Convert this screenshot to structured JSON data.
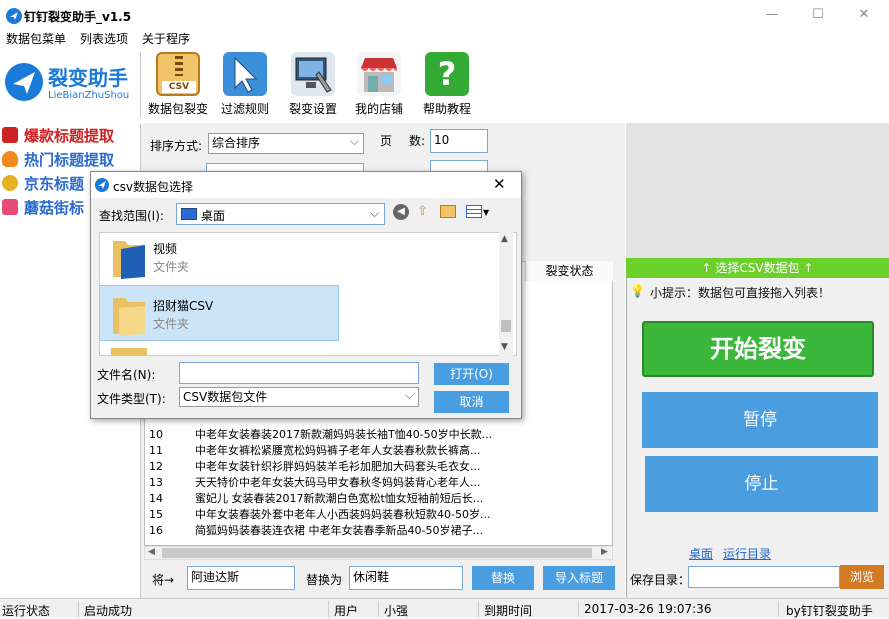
{
  "window": {
    "title": "钉钉裂变助手_v1.5",
    "minimize_icon": "minimize-icon",
    "maximize_icon": "maximize-icon",
    "close_icon": "close-icon"
  },
  "menu": [
    "数据包菜单",
    "列表选项",
    "关于程序"
  ],
  "logo": {
    "cn": "裂变助手",
    "en": "LieBianZhuShou"
  },
  "toolbar": [
    {
      "label": "数据包裂变",
      "icon": "csv-zip-icon",
      "color": "#e8a53a"
    },
    {
      "label": "过滤规则",
      "icon": "cursor-arrow-icon",
      "color": "#3b8fd8"
    },
    {
      "label": "裂变设置",
      "icon": "monitor-wrench-icon",
      "color": "#5577aa"
    },
    {
      "label": "我的店铺",
      "icon": "shop-icon",
      "color": "#cc4444"
    },
    {
      "label": "帮助教程",
      "icon": "help-question-icon",
      "color": "#33aa33"
    }
  ],
  "nav": [
    {
      "label": "爆款标题提取",
      "icon": "explode-icon",
      "color": "#cc2222"
    },
    {
      "label": "热门标题提取",
      "icon": "fire-icon",
      "color": "#2a6ad0"
    },
    {
      "label": "京东标题",
      "icon": "jd-icon",
      "color": "#2a6ad0"
    },
    {
      "label": "蘑菇街标",
      "icon": "mogujie-icon",
      "color": "#2a6ad0"
    }
  ],
  "form": {
    "sort_label": "排序方式:",
    "sort_value": "综合排序",
    "page_label_a": "页",
    "page_label_b": "数:",
    "page_value": "10"
  },
  "list": {
    "header_status": "裂变状态",
    "rows": [
      {
        "num": "10",
        "title": "中老年女装春装2017新款潮妈妈装长袖T恤40-50岁中长款..."
      },
      {
        "num": "11",
        "title": "中老年女裤松紧腰宽松妈妈裤子老年人女装春秋款长裤高..."
      },
      {
        "num": "12",
        "title": "中老年女装针织衫胖妈妈装羊毛衫加肥加大码套头毛衣女..."
      },
      {
        "num": "13",
        "title": "天天特价中老年女装大码马甲女春秋冬妈妈装背心老年人..."
      },
      {
        "num": "14",
        "title": "蜜妃儿 女装春装2017新款潮白色宽松t恤女短袖前短后长..."
      },
      {
        "num": "15",
        "title": "中年女装春装外套中老年人小西装妈妈装春秋短款40-50岁..."
      },
      {
        "num": "16",
        "title": "简狐妈妈装春装连衣裙 中老年女装春季新品40-50岁裙子..."
      }
    ]
  },
  "bottom": {
    "replace_from_label": "将→",
    "replace_from_value": "阿迪达斯",
    "replace_to_label": "替换为",
    "replace_to_value": "休闲鞋",
    "replace_button": "替换",
    "import_button": "导入标题"
  },
  "right": {
    "csv_bar": "↑ 选择CSV数据包 ↑",
    "tip": "小提示：数据包可直接拖入列表！",
    "start_button": "开始裂变",
    "pause_button": "暂停",
    "stop_button": "停止",
    "desktop_link": "桌面",
    "run_dir_link": "运行目录",
    "save_label": "保存目录：",
    "browse_button": "浏览"
  },
  "status": {
    "run_label": "运行状态",
    "run_value": "启动成功",
    "user_label": "用户",
    "user_value": "小强",
    "expire_label": "到期时间",
    "expire_value": "2017-03-26 19:07:36",
    "by": "by钉钉裂变助手"
  },
  "dialog": {
    "title": "csv数据包选择",
    "lookin_label": "查找范围(I):",
    "lookin_value": "桌面",
    "folders": [
      {
        "name": "视频",
        "type": "文件夹"
      },
      {
        "name": "招财猫CSV",
        "type": "文件夹"
      }
    ],
    "filename_label": "文件名(N):",
    "filename_value": "",
    "filetype_label": "文件类型(T):",
    "filetype_value": "CSV数据包文件",
    "open_button": "打开(O)",
    "cancel_button": "取消"
  }
}
